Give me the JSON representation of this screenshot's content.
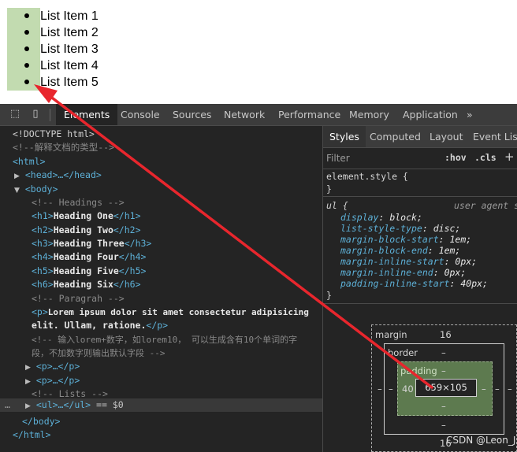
{
  "list": {
    "items": [
      "List Item 1",
      "List Item 2",
      "List Item 3",
      "List Item 4",
      "List Item 5"
    ]
  },
  "toolbar": {
    "tabs": [
      "Elements",
      "Console",
      "Sources",
      "Network",
      "Performance",
      "Memory",
      "Application"
    ],
    "more": "»"
  },
  "elements": {
    "doctype": "<!DOCTYPE html>",
    "comment_doctype": "<!--解释文档的类型-->",
    "html_open": "<html>",
    "head": "<head>…</head>",
    "body_open": "<body>",
    "c_headings": "<!-- Headings -->",
    "h1_open": "<h1>",
    "h1_text": "Heading One",
    "h1_close": "</h1>",
    "h2_open": "<h2>",
    "h2_text": "Heading Two",
    "h2_close": "</h2>",
    "h3_open": "<h3>",
    "h3_text": "Heading Three",
    "h3_close": "</h3>",
    "h4_open": "<h4>",
    "h4_text": "Heading Four",
    "h4_close": "</h4>",
    "h5_open": "<h5>",
    "h5_text": "Heading Five",
    "h5_close": "</h5>",
    "h6_open": "<h6>",
    "h6_text": "Heading Six",
    "h6_close": "</h6>",
    "c_paragrah": "<!-- Paragrah -->",
    "p_open": "<p>",
    "p_text1": "Lorem ipsum dolor sit amet consectetur adipisicing",
    "p_text2": "elit. Ullam, ratione.",
    "p_close": "</p>",
    "c_lorem1": "<!-- 输入lorem+数字，如lorem10， 可以生成含有10个单词的字",
    "c_lorem2": "段，不加数字则输出默认字段 -->",
    "p_collapsed": "<p>…</p>",
    "c_lists": "<!-- Lists -->",
    "ul_collapsed": "<ul>…</ul>",
    "eq_ref": "== $0",
    "body_close": "</body>",
    "html_close": "</html>",
    "gutter_dots": "…"
  },
  "styles": {
    "tabs": [
      "Styles",
      "Computed",
      "Layout",
      "Event Liste"
    ],
    "filter_placeholder": "Filter",
    "hov": ":hov",
    "cls": ".cls",
    "plus": "+",
    "element_style": "element.style {",
    "close_brace": "}",
    "ul_rule": "ul {",
    "user_agent": "user agent s",
    "declarations": [
      {
        "prop": "display",
        "val": "block;"
      },
      {
        "prop": "list-style-type",
        "val": "disc;"
      },
      {
        "prop": "margin-block-start",
        "val": "1em;"
      },
      {
        "prop": "margin-block-end",
        "val": "1em;"
      },
      {
        "prop": "margin-inline-start",
        "val": "0px;"
      },
      {
        "prop": "margin-inline-end",
        "val": "0px;"
      },
      {
        "prop": "padding-inline-start",
        "val": "40px;"
      }
    ]
  },
  "box_model": {
    "margin_label": "margin",
    "margin_top": "16",
    "margin_bottom": "16",
    "margin_left": "–",
    "margin_right": "–",
    "border_label": "border",
    "border_top": "–",
    "border_bottom": "–",
    "border_left": "–",
    "border_right": "–",
    "padding_label": "padding",
    "padding_top": "–",
    "padding_bottom": "–",
    "padding_left": "40",
    "padding_right": "–",
    "content": "659×105"
  },
  "watermark": "CSDN @Leon_J",
  "colors": {
    "arrow": "#e8262d",
    "highlight": "#c2dbb0",
    "tag": "#5db0d7"
  }
}
